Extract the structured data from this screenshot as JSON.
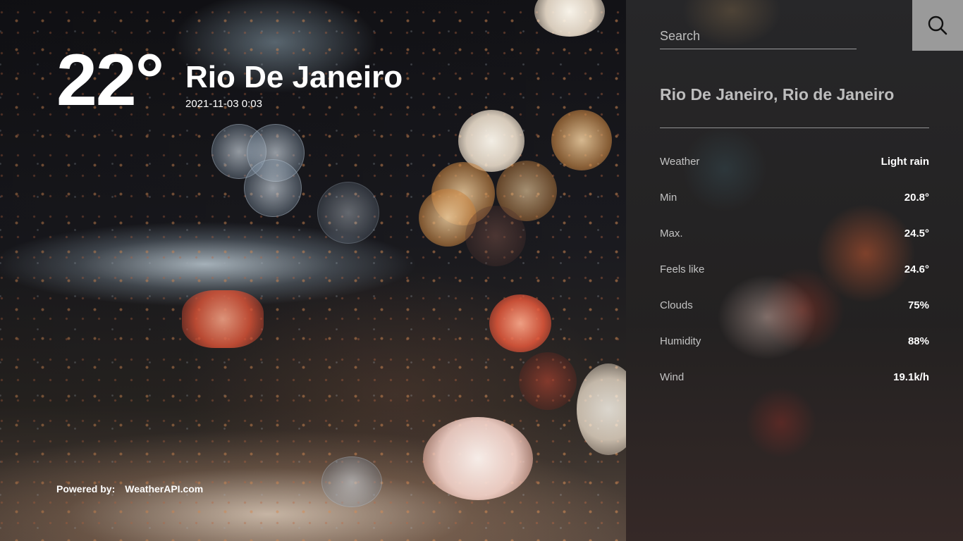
{
  "current": {
    "temperature": "22°",
    "city": "Rio De Janeiro",
    "datetime": "2021-11-03 0:03"
  },
  "footer": {
    "powered_label": "Powered by:",
    "provider": "WeatherAPI.com"
  },
  "search": {
    "placeholder": "Search",
    "icon": "search-icon"
  },
  "panel": {
    "location": "Rio De Janeiro, Rio de Janeiro",
    "details": [
      {
        "label": "Weather",
        "value": "Light rain"
      },
      {
        "label": "Min",
        "value": "20.8°"
      },
      {
        "label": "Max.",
        "value": "24.5°"
      },
      {
        "label": "Feels like",
        "value": "24.6°"
      },
      {
        "label": "Clouds",
        "value": "75%"
      },
      {
        "label": "Humidity",
        "value": "88%"
      },
      {
        "label": "Wind",
        "value": "19.1k/h"
      }
    ]
  },
  "colors": {
    "search_button_bg": "#9a9a9a",
    "panel_bg": "#282828",
    "muted_text": "#bdbdbd"
  }
}
